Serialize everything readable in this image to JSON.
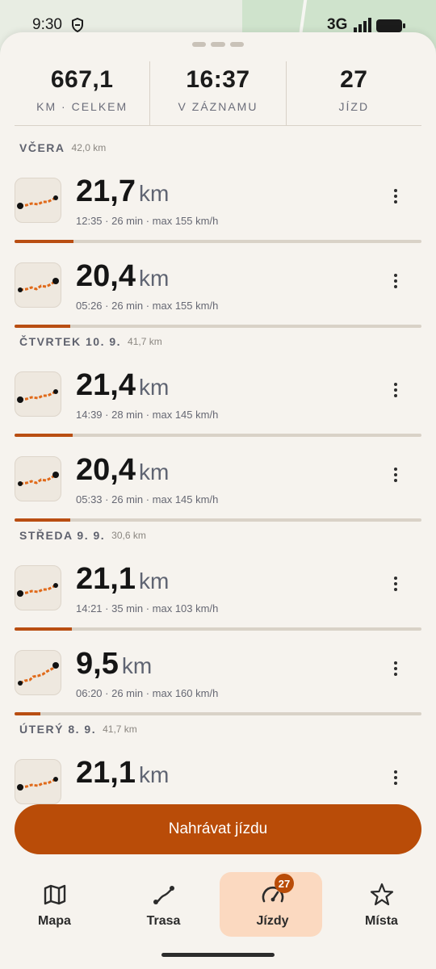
{
  "status_bar": {
    "time": "9:30",
    "network": "3G"
  },
  "summary": {
    "stats": [
      {
        "value": "667,1",
        "label": "KM · CELKEM"
      },
      {
        "value": "16:37",
        "label": "V ZÁZNAMU"
      },
      {
        "value": "27",
        "label": "JÍZD"
      }
    ]
  },
  "days": [
    {
      "title": "VČERA",
      "total": "42,0 km",
      "rides": [
        {
          "distance": "21,7",
          "unit": "km",
          "meta": "12:35 · 26 min · max 155 km/h",
          "progress": 0.145
        },
        {
          "distance": "20,4",
          "unit": "km",
          "meta": "05:26 · 26 min · max 155 km/h",
          "progress": 0.136
        }
      ]
    },
    {
      "title": "ČTVRTEK 10. 9.",
      "total": "41,7 km",
      "rides": [
        {
          "distance": "21,4",
          "unit": "km",
          "meta": "14:39 · 28 min · max 145 km/h",
          "progress": 0.143
        },
        {
          "distance": "20,4",
          "unit": "km",
          "meta": "05:33 · 26 min · max 145 km/h",
          "progress": 0.136
        }
      ]
    },
    {
      "title": "STŘEDA 9. 9.",
      "total": "30,6 km",
      "rides": [
        {
          "distance": "21,1",
          "unit": "km",
          "meta": "14:21 · 35 min · max 103 km/h",
          "progress": 0.141
        },
        {
          "distance": "9,5",
          "unit": "km",
          "meta": "06:20 · 26 min · max 160 km/h",
          "progress": 0.063
        }
      ]
    },
    {
      "title": "ÚTERÝ 8. 9.",
      "total": "41,7 km",
      "rides": [
        {
          "distance": "21,1",
          "unit": "km",
          "meta": "",
          "progress": 0.141
        }
      ]
    }
  ],
  "record_button": "Nahrávat jízdu",
  "nav": {
    "items": [
      {
        "label": "Mapa",
        "icon": "map-icon"
      },
      {
        "label": "Trasa",
        "icon": "route-icon"
      },
      {
        "label": "Jízdy",
        "icon": "speedometer-icon",
        "badge": "27",
        "active": true
      },
      {
        "label": "Místa",
        "icon": "star-icon"
      }
    ]
  },
  "colors": {
    "accent": "#b94c08",
    "active_nav": "#fbd9c0",
    "sheet": "#f6f3ee"
  }
}
